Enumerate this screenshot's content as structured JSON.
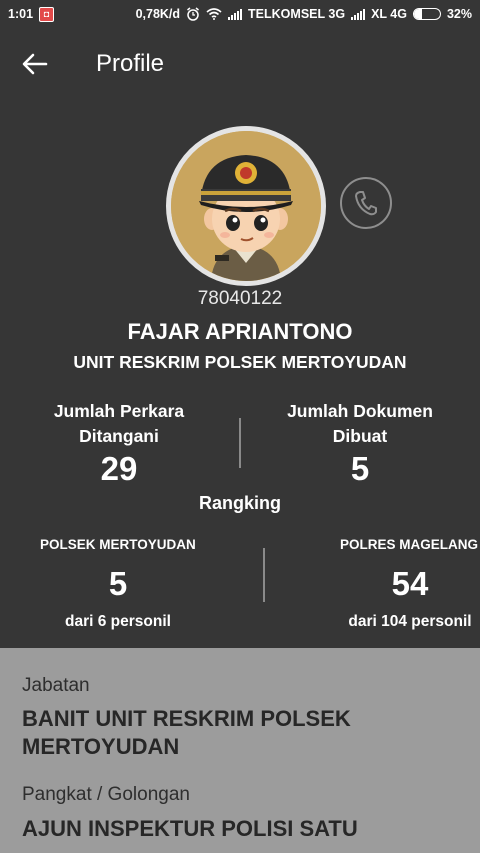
{
  "status_bar": {
    "time": "1:01",
    "speed": "0,78K/d",
    "carrier1": "TELKOMSEL 3G",
    "carrier2": "XL 4G",
    "battery_percent": "32%",
    "battery_level": 0.32
  },
  "app_bar": {
    "title": "Profile",
    "back_icon": "arrow-left-icon"
  },
  "profile": {
    "nrp": "78040122",
    "name": "FAJAR APRIANTONO",
    "unit": "UNIT RESKRIM POLSEK MERTOYUDAN",
    "call_icon": "phone-icon"
  },
  "stats": {
    "cases_label_line1": "Jumlah Perkara",
    "cases_label_line2": "Ditangani",
    "cases_value": "29",
    "docs_label_line1": "Jumlah Dokumen",
    "docs_label_line2": "Dibuat",
    "docs_value": "5"
  },
  "ranking": {
    "title": "Rangking",
    "left_org": "POLSEK MERTOYUDAN",
    "left_rank": "5",
    "left_sub": "dari 6 personil",
    "right_org": "POLRES MAGELANG",
    "right_rank": "54",
    "right_sub": "dari 104 personil"
  },
  "details": {
    "jabatan_label": "Jabatan",
    "jabatan_value": "BANIT UNIT RESKRIM POLSEK MERTOYUDAN",
    "pangkat_label": "Pangkat / Golongan",
    "pangkat_value": "AJUN INSPEKTUR POLISI SATU"
  }
}
